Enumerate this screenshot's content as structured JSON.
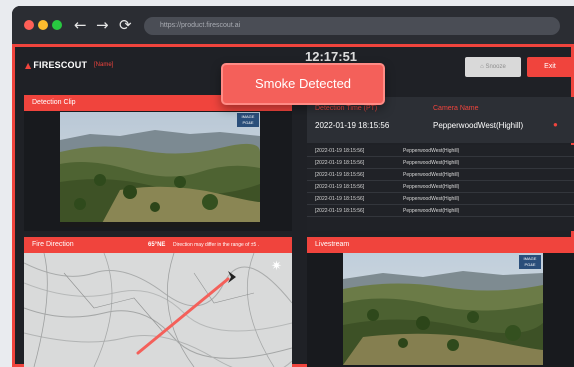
{
  "browser": {
    "url": "https://product.firescout.ai",
    "nav_back": "←",
    "nav_forward": "→",
    "nav_reload": "⟳"
  },
  "header": {
    "logo_text": "FIRESCOUT",
    "user_placeholder": "[Name]",
    "clock": "12:17:51",
    "snooze_label": "Snooze",
    "exit_label": "Exit"
  },
  "toast": {
    "text": "Smoke Detected"
  },
  "detection_clip": {
    "title": "Detection Clip",
    "badge_line1": "IMAGE",
    "badge_line2": "PG&E"
  },
  "detection_info": {
    "time_label": "Detection Time (PT)",
    "time_value": "2022-01-19 18:15:56",
    "camera_label": "Camera Name",
    "camera_value": "PepperwoodWest(Highill)"
  },
  "detections": [
    {
      "time": "[2022-01-19 18:15:56]",
      "camera": "PepperwoodWest(Highill)"
    },
    {
      "time": "[2022-01-19 18:15:56]",
      "camera": "PepperwoodWest(Highill)"
    },
    {
      "time": "[2022-01-19 18:15:56]",
      "camera": "PepperwoodWest(Highill)"
    },
    {
      "time": "[2022-01-19 18:15:56]",
      "camera": "PepperwoodWest(Highill)"
    },
    {
      "time": "[2022-01-19 18:15:56]",
      "camera": "PepperwoodWest(Highill)"
    },
    {
      "time": "[2022-01-19 18:15:56]",
      "camera": "PepperwoodWest(Highill)"
    }
  ],
  "fire_direction": {
    "title": "Fire Direction",
    "bearing": "65°NE",
    "note": "Direction may differ in the range of ±5 ."
  },
  "livestream": {
    "title": "Livestream",
    "badge_line1": "IMAGE",
    "badge_line2": "PG&E"
  },
  "colors": {
    "accent": "#f0443d",
    "panel": "#1f2126",
    "toast": "#f4605a"
  }
}
